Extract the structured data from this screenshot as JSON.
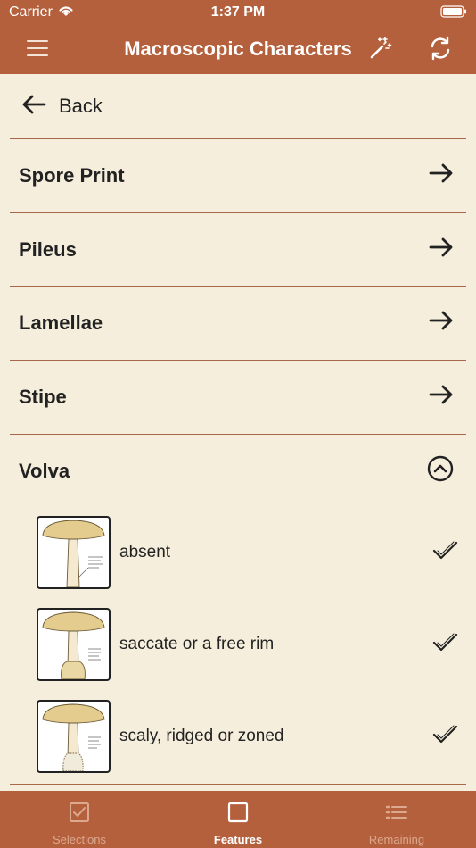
{
  "status_bar": {
    "carrier": "Carrier",
    "time": "1:37 PM"
  },
  "nav": {
    "title": "Macroscopic Characters",
    "menu_icon": "hamburger-icon",
    "magic_icon": "magic-wand-icon",
    "refresh_icon": "refresh-icon"
  },
  "back": {
    "label": "Back"
  },
  "sections": [
    {
      "label": "Spore Print",
      "icon": "arrow-right-icon"
    },
    {
      "label": "Pileus",
      "icon": "arrow-right-icon"
    },
    {
      "label": "Lamellae",
      "icon": "arrow-right-icon"
    },
    {
      "label": "Stipe",
      "icon": "arrow-right-icon"
    },
    {
      "label": "Volva",
      "icon": "chevron-up-circle-icon",
      "expanded": true
    }
  ],
  "options": [
    {
      "label": "absent",
      "checked": true
    },
    {
      "label": "saccate or a free rim",
      "checked": true
    },
    {
      "label": "scaly, ridged or zoned",
      "checked": true
    }
  ],
  "tabs": [
    {
      "label": "Selections",
      "icon": "checkbox-icon",
      "active": false
    },
    {
      "label": "Features",
      "icon": "square-icon",
      "active": true
    },
    {
      "label": "Remaining",
      "icon": "list-icon",
      "active": false
    }
  ],
  "colors": {
    "brand": "#b5603d",
    "background": "#f5eedc",
    "divider": "#a8694a",
    "inactive_tab": "#dca88f"
  }
}
